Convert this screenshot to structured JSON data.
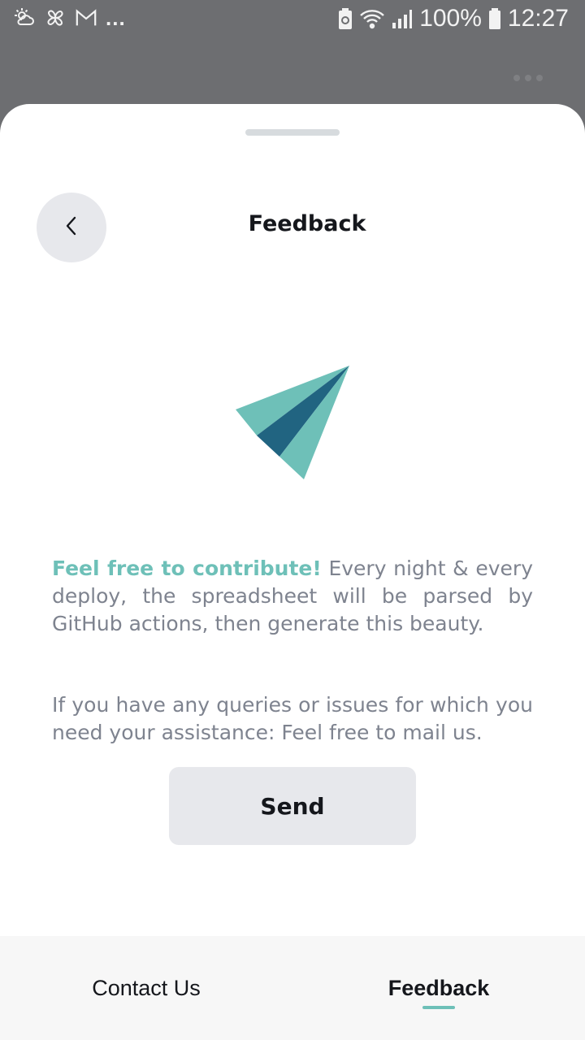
{
  "status_bar": {
    "left_icons": [
      "weather-icon",
      "pinwheel-icon",
      "gmail-icon"
    ],
    "overflow": "...",
    "battery_percent": "100%",
    "time": "12:27"
  },
  "sheet": {
    "title": "Feedback",
    "back_icon": "chevron-left-icon",
    "illustration": "paper-plane-icon",
    "paragraph1_highlight": "Feel free to contribute!",
    "paragraph1_text": " Every night & every deploy, the spreadsheet will be parsed by GitHub actions, then generate this beauty.",
    "paragraph2_text": "If you have any queries or issues for which you need your assistance: Feel free to mail us.",
    "send_label": "Send"
  },
  "bottom_nav": {
    "items": [
      {
        "label": "Contact Us",
        "active": false
      },
      {
        "label": "Feedback",
        "active": true
      }
    ]
  },
  "colors": {
    "accent": "#6ec0b8",
    "plane_dark": "#216481",
    "button_bg": "#e7e8ec",
    "text_muted": "#7e838f"
  }
}
